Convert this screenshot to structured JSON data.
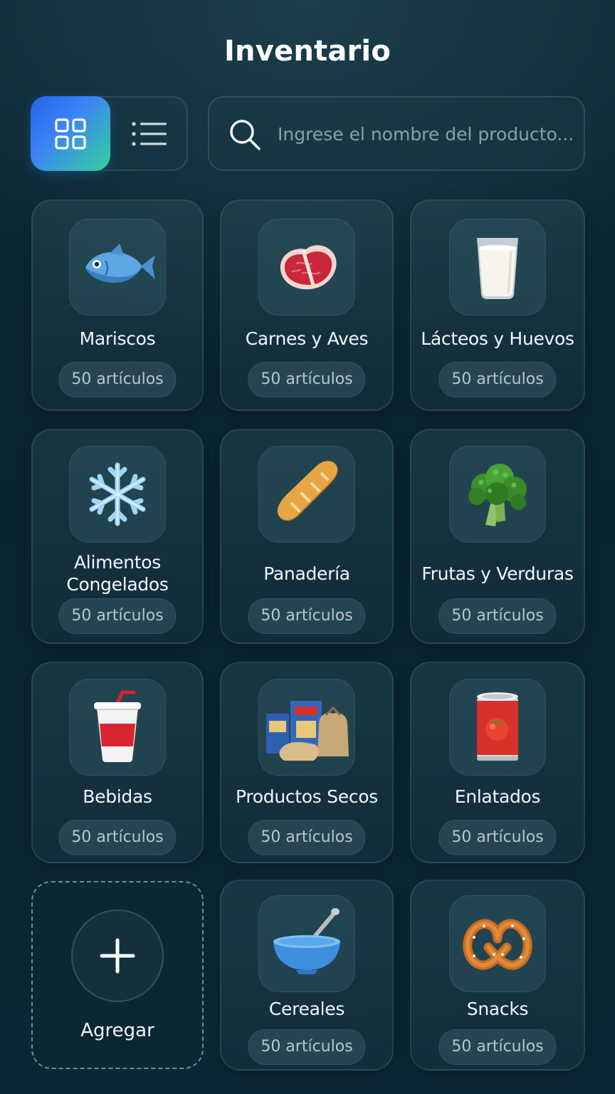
{
  "header": {
    "title": "Inventario"
  },
  "view_toggle": {
    "active": "grid",
    "grid_icon": "grid-icon",
    "list_icon": "list-icon"
  },
  "search": {
    "placeholder": "Ingrese el nombre del producto...",
    "icon": "search-icon"
  },
  "categories": [
    {
      "label": "Mariscos",
      "count": "50 artículos",
      "icon": "fish-icon"
    },
    {
      "label": "Carnes y Aves",
      "count": "50 artículos",
      "icon": "steak-icon"
    },
    {
      "label": "Lácteos y Huevos",
      "count": "50 artículos",
      "icon": "milk-glass-icon"
    },
    {
      "label": "Alimentos Congelados",
      "count": "50 artículos",
      "icon": "snowflake-icon"
    },
    {
      "label": "Panadería",
      "count": "50 artículos",
      "icon": "bread-icon"
    },
    {
      "label": "Frutas y Verduras",
      "count": "50 artículos",
      "icon": "broccoli-icon"
    },
    {
      "label": "Bebidas",
      "count": "50 artículos",
      "icon": "drink-cup-icon"
    },
    {
      "label": "Productos Secos",
      "count": "50 artículos",
      "icon": "dry-goods-icon"
    },
    {
      "label": "Enlatados",
      "count": "50 artículos",
      "icon": "tomato-can-icon"
    },
    {
      "label": "Cereales",
      "count": "50 artículos",
      "icon": "bowl-icon"
    },
    {
      "label": "Snacks",
      "count": "50 artículos",
      "icon": "pretzel-icon"
    }
  ],
  "add_card": {
    "label": "Agregar",
    "icon": "plus-icon"
  },
  "colors": {
    "background": "#0b2634",
    "accent_start": "#2563eb",
    "accent_end": "#34d399",
    "text": "#ffffff"
  }
}
